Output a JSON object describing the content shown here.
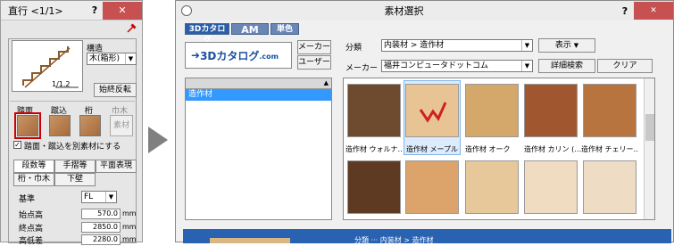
{
  "left_panel": {
    "title": "直行  <1/1>",
    "help": "?",
    "close": "✕",
    "structure_label": "構造",
    "structure_value": "木(箱形)",
    "ratio": "1/1.2",
    "flip_button": "始終反転",
    "tread_label": "踏面",
    "riser_label": "蹴込",
    "stringer_label": "桁",
    "skirting_label": "巾木",
    "material_button": "素材",
    "checkbox_label": "踏面・蹴込を別素材にする",
    "tabs": [
      "段数等",
      "手摺等",
      "平面表現",
      "桁・巾木",
      "下壁"
    ],
    "base_label": "基準",
    "base_value": "FL",
    "start_height_label": "始点高",
    "start_height_value": "570.0",
    "end_height_label": "終点高",
    "end_height_value": "2850.0",
    "height_diff_label": "高低差",
    "height_diff_value": "2280.0",
    "unit": "mm"
  },
  "dialog": {
    "title": "素材選択",
    "help": "?",
    "close": "✕",
    "tabs": [
      "3Dカタログ",
      "AM",
      "単色"
    ],
    "logo_text": "3Dカタログ",
    "logo_suffix": ".com",
    "maker_button": "メーカー",
    "user_button": "ユーザー",
    "category_label": "分類",
    "category_value": "内装材 > 造作材",
    "display_button": "表示",
    "maker_label": "メーカー",
    "maker_value": "福井コンピュータドットコム",
    "search_button": "詳細検索",
    "clear_button": "クリア",
    "tree_selected": "造作材",
    "materials": [
      {
        "label": "造作材 ウォルナ…",
        "color": "#6e4a2e"
      },
      {
        "label": "造作材 メープル",
        "color": "#e8c495"
      },
      {
        "label": "造作材 オーク",
        "color": "#d4a86a"
      },
      {
        "label": "造作材 カリン (…",
        "color": "#a0562e"
      },
      {
        "label": "造作材 チェリー…",
        "color": "#b8743e"
      },
      {
        "label": "",
        "color": "#5e3a22"
      },
      {
        "label": "",
        "color": "#dca46a"
      },
      {
        "label": "",
        "color": "#e6c89a"
      },
      {
        "label": "",
        "color": "#f0dcc0"
      },
      {
        "label": "",
        "color": "#efdcc4"
      }
    ],
    "footer_text": "分類 ···  内装材 > 造作材"
  },
  "colors": {
    "close_red": "#c75050",
    "selection_blue": "#3399ff",
    "tab_blue": "#2c5ea8"
  }
}
